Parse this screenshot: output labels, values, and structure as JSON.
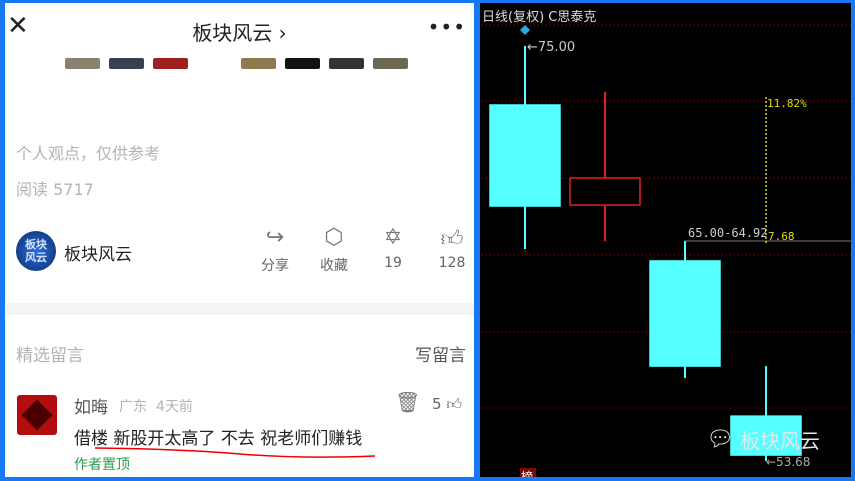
{
  "header": {
    "title": "板块风云",
    "chevron": "›",
    "close_icon": "close-icon",
    "more_icon": "more-icon"
  },
  "article": {
    "disclaimer": "个人观点，仅供参考",
    "reads": "阅读 5717"
  },
  "author": {
    "avatar_text": "板块风云",
    "name": "板块风云"
  },
  "actions": [
    {
      "icon": "share-icon",
      "label": "分享"
    },
    {
      "icon": "box-icon",
      "label": "收藏"
    },
    {
      "icon": "flower-icon",
      "label": "19"
    },
    {
      "icon": "thumbs-up-icon",
      "label": "128"
    }
  ],
  "comments": {
    "title": "精选留言",
    "write": "写留言",
    "items": [
      {
        "user": "如晦",
        "location": "广东",
        "time": "4天前",
        "likes": "5",
        "text": "借楼 新股开太高了 不去 祝老师们赚钱",
        "pinned": "作者置顶"
      }
    ]
  },
  "chart_data": {
    "type": "candlestick",
    "title": "日线(复权) C思泰克",
    "candles": [
      {
        "open": 71.97,
        "close": 66.78,
        "high": 75.0,
        "low": 64.57,
        "color": "down"
      },
      {
        "open": 66.83,
        "close": 68.22,
        "high": 72.64,
        "low": 64.98,
        "color": "up"
      },
      {
        "open": 63.96,
        "close": 58.56,
        "high": 65.0,
        "low": 57.95,
        "color": "down"
      },
      {
        "open": 55.99,
        "close": 53.99,
        "high": 58.56,
        "low": 53.68,
        "color": "down"
      }
    ],
    "annotations": {
      "high_label": "75.00",
      "low_label": "53.68",
      "range_label": "65.00-64.92",
      "pct_label": "11.82%",
      "diff_label": "7.68",
      "badge": "榜"
    },
    "colors": {
      "down": "#55ffff",
      "up": "#e02020",
      "grid": "#a01010",
      "measure": "#e0e000"
    }
  },
  "watermark": "板块风云"
}
